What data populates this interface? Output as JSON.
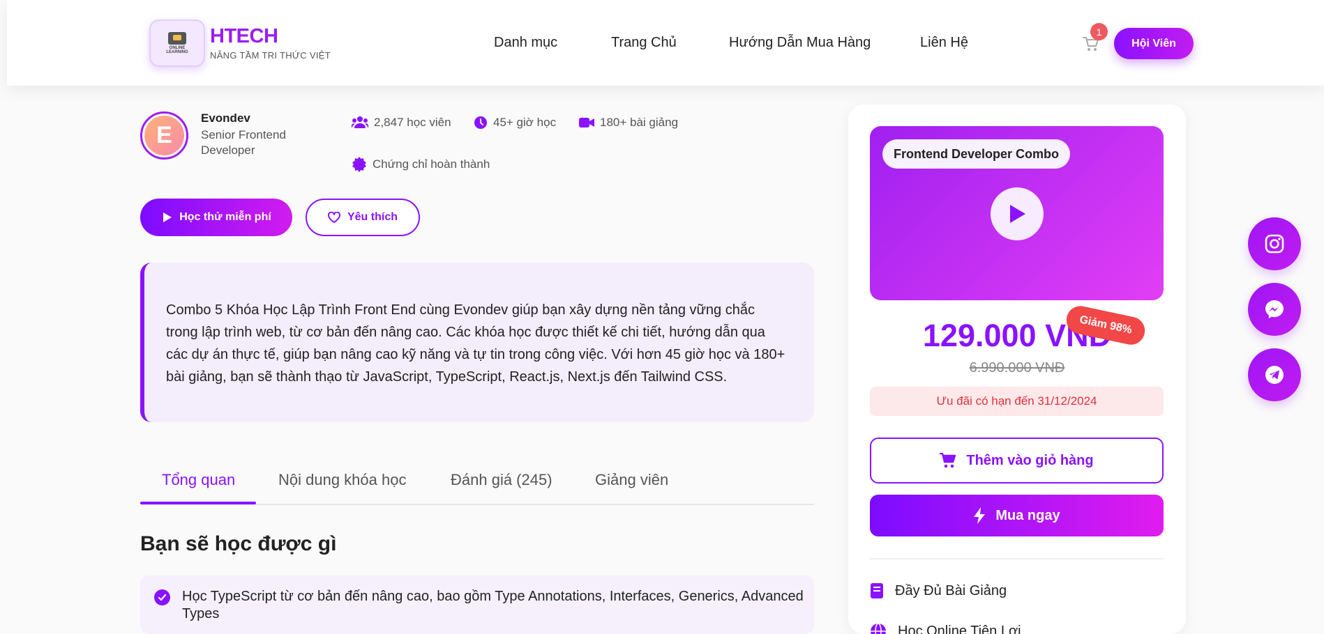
{
  "header": {
    "logo_caption": "ONLINE LEARNING",
    "brand_name": "HTECH",
    "brand_tagline": "NÂNG TẦM TRI THỨC VIỆT",
    "nav": [
      "Danh mục",
      "Trang Chủ",
      "Hướng Dẫn Mua Hàng",
      "Liên Hệ"
    ],
    "cart_count": "1",
    "member_button": "Hội Viên"
  },
  "instructor": {
    "initial": "E",
    "name": "Evondev",
    "title": "Senior Frontend Developer"
  },
  "stats": {
    "students": "2,847 học viên",
    "hours": "45+ giờ học",
    "lessons": "180+ bài giảng",
    "certificate": "Chứng chỉ hoàn thành"
  },
  "actions": {
    "try_free": "Học thử miễn phí",
    "favorite": "Yêu thích"
  },
  "description": "Combo 5 Khóa Học Lập Trình Front End cùng Evondev giúp bạn xây dựng nền tảng vững chắc trong lập trình web, từ cơ bản đến nâng cao. Các khóa học được thiết kế chi tiết, hướng dẫn qua các dự án thực tế, giúp bạn nâng cao kỹ năng và tự tin trong công việc. Với hơn 45 giờ học và 180+ bài giảng, bạn sẽ thành thạo từ JavaScript, TypeScript, React.js, Next.js đến Tailwind CSS.",
  "tabs": [
    "Tổng quan",
    "Nội dung khóa học",
    "Đánh giá (245)",
    "Giảng viên"
  ],
  "active_tab": "Tổng quan",
  "learn": {
    "title": "Bạn sẽ học được gì",
    "items": [
      "Học TypeScript từ cơ bản đến nâng cao, bao gồm Type Annotations, Interfaces, Generics, Advanced Types"
    ]
  },
  "card": {
    "video_label": "Frontend Developer Combo",
    "price": "129.000 VNĐ",
    "discount": "Giảm 98%",
    "old_price": "6.990.000 VNĐ",
    "offer": "Ưu đãi có hạn đến 31/12/2024",
    "add_to_cart": "Thêm vào giỏ hàng",
    "buy_now": "Mua ngay",
    "features": [
      "Đầy Đủ Bài Giảng",
      "Học Online Tiện Lợi"
    ]
  },
  "social": [
    "instagram-icon",
    "messenger-icon",
    "telegram-icon"
  ],
  "colors": {
    "accent": "#8a12ff",
    "accent_pink": "#d21cef",
    "offer_red": "#e0303c",
    "badge_red": "#f24747"
  }
}
